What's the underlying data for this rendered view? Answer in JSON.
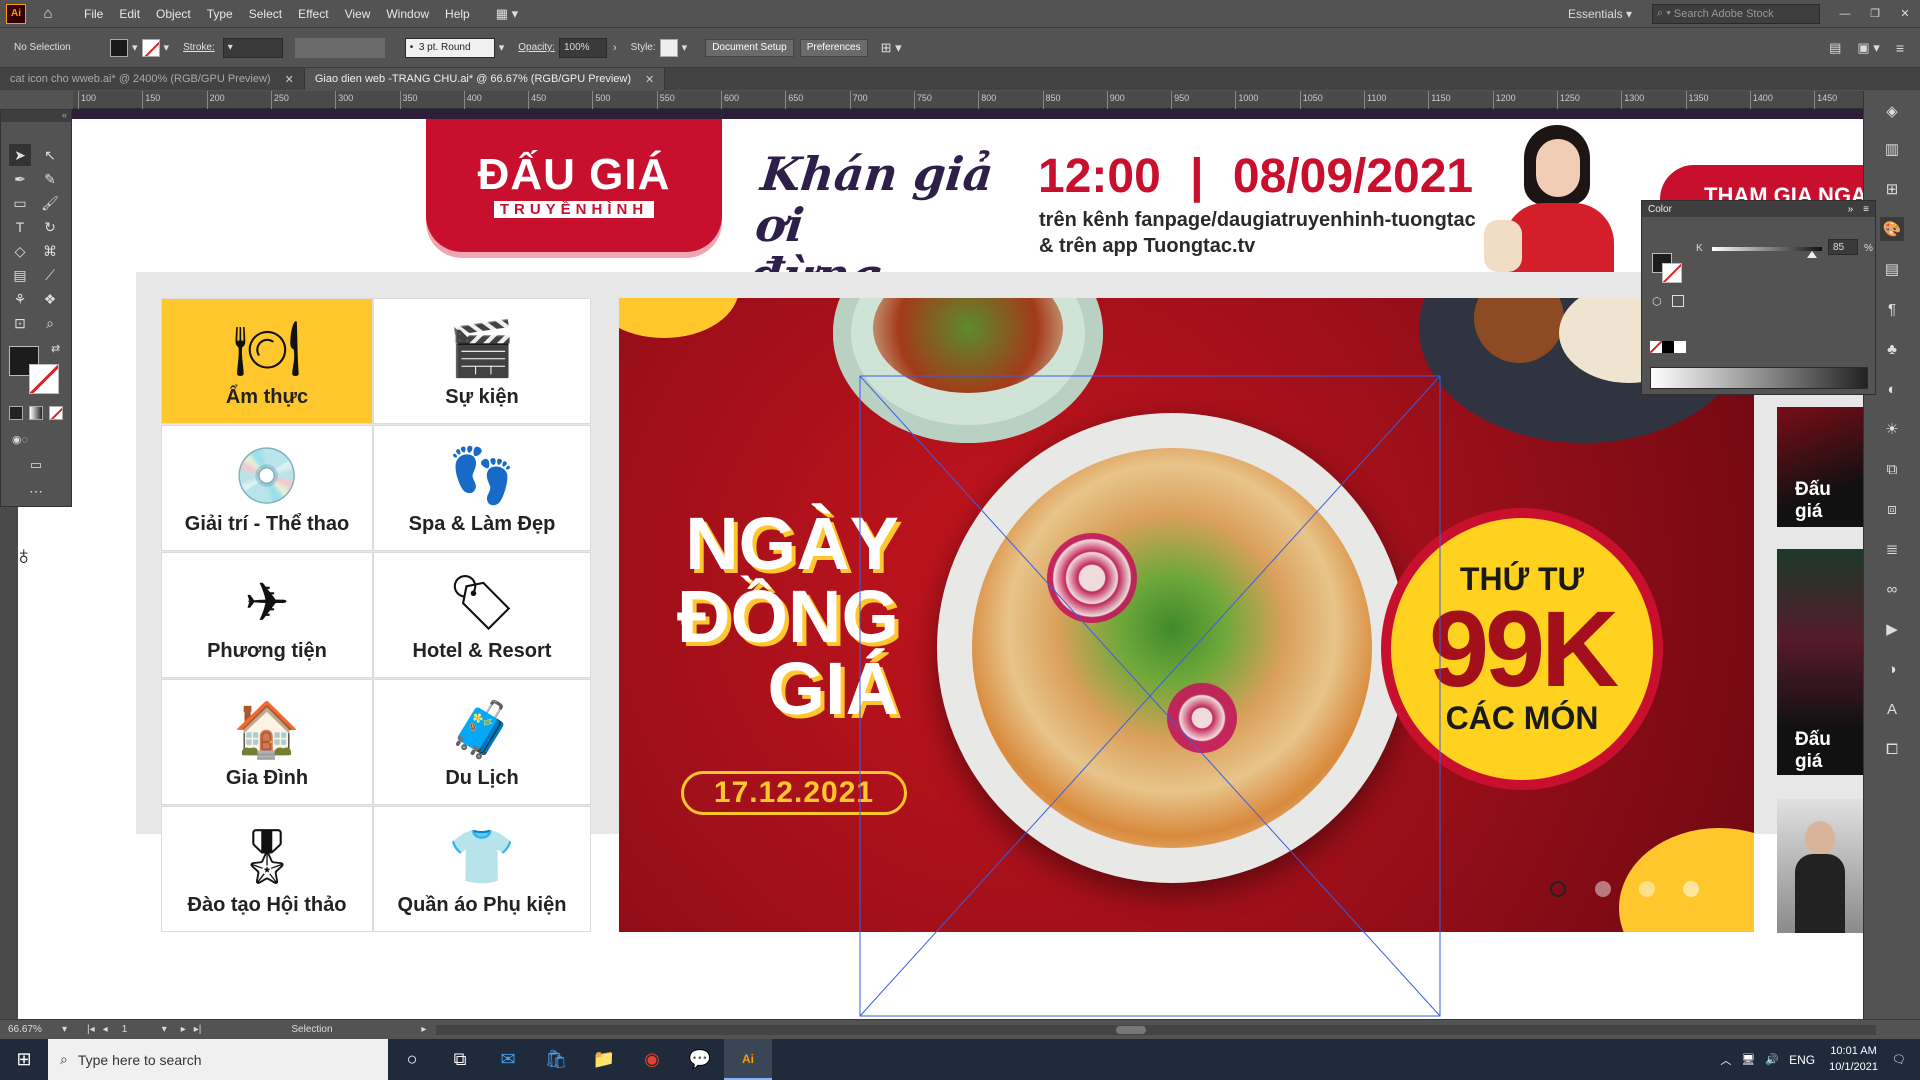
{
  "menu": [
    "File",
    "Edit",
    "Object",
    "Type",
    "Select",
    "Effect",
    "View",
    "Window",
    "Help"
  ],
  "workspace": "Essentials",
  "search_stock_placeholder": "Search Adobe Stock",
  "control": {
    "selection": "No Selection",
    "stroke_label": "Stroke:",
    "brush": "3 pt. Round",
    "opacity_label": "Opacity:",
    "opacity_value": "100%",
    "style_label": "Style:",
    "document_setup": "Document Setup",
    "preferences": "Preferences"
  },
  "tabs": [
    {
      "label": "cat icon cho wweb.ai* @ 2400% (RGB/GPU Preview)",
      "active": false
    },
    {
      "label": "Giao dien web -TRANG CHU.ai* @ 66.67% (RGB/GPU Preview)",
      "active": true
    }
  ],
  "ruler_ticks": [
    "100",
    "150",
    "200",
    "250",
    "300",
    "350",
    "400",
    "450",
    "500",
    "550",
    "600",
    "650",
    "700",
    "750",
    "800",
    "850",
    "900",
    "950",
    "1000",
    "1050",
    "1100",
    "1150",
    "1200",
    "1250",
    "1300",
    "1350",
    "1400",
    "1450"
  ],
  "color_panel": {
    "title": "Color",
    "channel": "K",
    "value": "85",
    "unit": "%"
  },
  "status": {
    "zoom": "66.67%",
    "artboard": "1",
    "tool": "Selection"
  },
  "taskbar": {
    "search_placeholder": "Type here to search",
    "lang": "ENG",
    "time": "10:01 AM",
    "date": "10/1/2021"
  },
  "site": {
    "logo_main": "ĐẤU GIÁ",
    "logo_sub": "TRUYỀNHÌNH",
    "tagline_1": "Khán giả ơi",
    "tagline_2": "đừng quên!",
    "time": "12:00",
    "separator": "|",
    "date": "08/09/2021",
    "channel_line1": "trên kênh fanpage/daugiatruyenhinh-tuongtac",
    "channel_line2": "& trên app Tuongtac.tv",
    "cta_partial": "THAM GIA NGAY",
    "categories": [
      {
        "label": "Ẩm thực",
        "icon": "food-cloche-icon",
        "glyph": "🍽"
      },
      {
        "label": "Sự kiện",
        "icon": "clapperboard-icon",
        "glyph": "🎬"
      },
      {
        "label": "Giải trí - Thể thao",
        "icon": "music-disc-icon",
        "glyph": "💿"
      },
      {
        "label": "Spa & Làm Đẹp",
        "icon": "footprints-icon",
        "glyph": "👣"
      },
      {
        "label": "Phương tiện",
        "icon": "airplane-icon",
        "glyph": "✈"
      },
      {
        "label": "Hotel & Resort",
        "icon": "door-hanger-icon",
        "glyph": "🏷"
      },
      {
        "label": "Gia Đình",
        "icon": "house-icon",
        "glyph": "🏠"
      },
      {
        "label": "Du Lịch",
        "icon": "luggage-icon",
        "glyph": "🧳"
      },
      {
        "label": "Đào tạo Hội thảo",
        "icon": "award-ribbon-icon",
        "glyph": "🎖"
      },
      {
        "label": "Quần áo Phụ kiện",
        "icon": "tshirt-icon",
        "glyph": "👕"
      }
    ],
    "banner": {
      "title_1": "NGÀY",
      "title_2": "ĐỒNG",
      "title_3": "GIÁ",
      "date": "17.12.2021",
      "badge_top": "THỨ TƯ",
      "badge_price": "99K",
      "badge_bottom": "CÁC MÓN"
    },
    "side_cards": [
      "Đấu giá",
      "Đấu giá"
    ],
    "colors": {
      "brand_red": "#c8102e",
      "yellow": "#ffc72c",
      "banner_red": "#a8121c"
    }
  }
}
